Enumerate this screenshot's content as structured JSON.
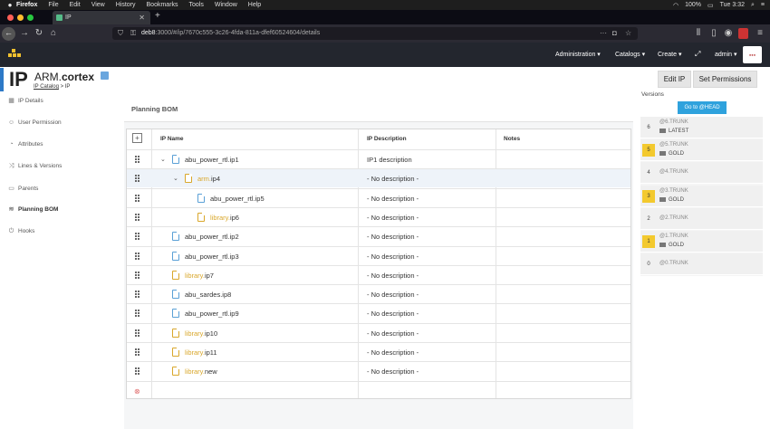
{
  "macbar": {
    "app": "Firefox",
    "menus": [
      "File",
      "Edit",
      "View",
      "History",
      "Bookmarks",
      "Tools",
      "Window",
      "Help"
    ],
    "battery": "100%",
    "time": "Tue 3:32"
  },
  "browser": {
    "tab_title": "IP",
    "url_host": "deb8",
    "url_rest": ":3000/#/ip/7670c555-3c26-4fda-811a-dfef60524604/details",
    "url_text": "deb8:3000/#/ip/7670c555-3c26-4fda-811a-dfef60524604/details"
  },
  "header": {
    "menus": [
      "Administration ▾",
      "Catalogs ▾",
      "Create ▾"
    ],
    "user": "admin ▾"
  },
  "ip": {
    "big": "IP",
    "prefix": "ARM.",
    "name": "cortex",
    "breadcrumb_link": "IP Catalog",
    "breadcrumb_sep": " > ",
    "breadcrumb_current": "IP"
  },
  "actions": {
    "edit": "Edit IP",
    "permissions": "Set Permissions"
  },
  "sidebar": {
    "items": [
      {
        "label": "IP Details",
        "icon": "grid-icon"
      },
      {
        "label": "User Permission",
        "icon": "user-icon"
      },
      {
        "label": "Attributes",
        "icon": "gauge-icon"
      },
      {
        "label": "Lines & Versions",
        "icon": "shuffle-icon"
      },
      {
        "label": "Parents",
        "icon": "folder-icon"
      },
      {
        "label": "Planning BOM",
        "icon": "layers-icon"
      },
      {
        "label": "Hooks",
        "icon": "power-icon"
      }
    ]
  },
  "bom": {
    "title": "Planning BOM",
    "columns": [
      "IP Name",
      "IP Description",
      "Notes"
    ],
    "rows": [
      {
        "prefix": "",
        "name": "abu_power_rtl.ip1",
        "desc": "IP1 description",
        "depth": 0,
        "expanded": true,
        "yellow": false
      },
      {
        "prefix": "arm.",
        "name": "ip4",
        "desc": "- No description -",
        "depth": 1,
        "expanded": true,
        "yellow": true
      },
      {
        "prefix": "",
        "name": "abu_power_rtl.ip5",
        "desc": "- No description -",
        "depth": 2,
        "expanded": false,
        "yellow": false
      },
      {
        "prefix": "library.",
        "name": "ip6",
        "desc": "- No description -",
        "depth": 2,
        "expanded": false,
        "yellow": true
      },
      {
        "prefix": "",
        "name": "abu_power_rtl.ip2",
        "desc": "- No description -",
        "depth": 0,
        "expanded": false,
        "yellow": false
      },
      {
        "prefix": "",
        "name": "abu_power_rtl.ip3",
        "desc": "- No description -",
        "depth": 0,
        "expanded": false,
        "yellow": false
      },
      {
        "prefix": "library.",
        "name": "ip7",
        "desc": "- No description -",
        "depth": 0,
        "expanded": false,
        "yellow": true
      },
      {
        "prefix": "",
        "name": "abu_sardes.ip8",
        "desc": "- No description -",
        "depth": 0,
        "expanded": false,
        "yellow": false
      },
      {
        "prefix": "",
        "name": "abu_power_rtl.ip9",
        "desc": "- No description -",
        "depth": 0,
        "expanded": false,
        "yellow": false
      },
      {
        "prefix": "library.",
        "name": "ip10",
        "desc": "- No description -",
        "depth": 0,
        "expanded": false,
        "yellow": true
      },
      {
        "prefix": "library.",
        "name": "ip11",
        "desc": "- No description -",
        "depth": 0,
        "expanded": false,
        "yellow": true
      },
      {
        "prefix": "library.",
        "name": "new",
        "desc": "- No description -",
        "depth": 0,
        "expanded": false,
        "yellow": true
      }
    ]
  },
  "versions": {
    "label": "Versions",
    "head_button": "Go to @HEAD",
    "items": [
      {
        "num": "6",
        "name": "@6.TRUNK",
        "tag": "LATEST",
        "gold": false
      },
      {
        "num": "5",
        "name": "@5.TRUNK",
        "tag": "GOLD",
        "gold": true
      },
      {
        "num": "4",
        "name": "@4.TRUNK",
        "tag": "",
        "gold": false
      },
      {
        "num": "3",
        "name": "@3.TRUNK",
        "tag": "GOLD",
        "gold": true
      },
      {
        "num": "2",
        "name": "@2.TRUNK",
        "tag": "",
        "gold": false
      },
      {
        "num": "1",
        "name": "@1.TRUNK",
        "tag": "GOLD",
        "gold": true
      },
      {
        "num": "0",
        "name": "@0.TRUNK",
        "tag": "",
        "gold": false
      }
    ]
  },
  "colors": {
    "accent": "#2d79c7",
    "gold": "#f3c92e",
    "library": "#d9a72b",
    "headbtn": "#2fa2dd"
  }
}
